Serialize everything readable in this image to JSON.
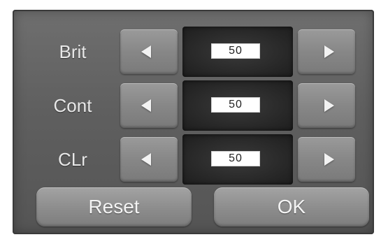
{
  "rows": [
    {
      "label": "Brit",
      "value": "50",
      "decrease_icon": "arrow-left-icon",
      "increase_icon": "arrow-right-icon"
    },
    {
      "label": "Cont",
      "value": "50",
      "decrease_icon": "arrow-left-icon",
      "increase_icon": "arrow-right-icon"
    },
    {
      "label": "CLr",
      "value": "50",
      "decrease_icon": "arrow-left-icon",
      "increase_icon": "arrow-right-icon"
    }
  ],
  "buttons": {
    "reset_label": "Reset",
    "ok_label": "OK"
  },
  "colors": {
    "panel": "#606060",
    "button": "#8a8a8a",
    "value_box": "#262626",
    "text": "#e8e8e8"
  }
}
